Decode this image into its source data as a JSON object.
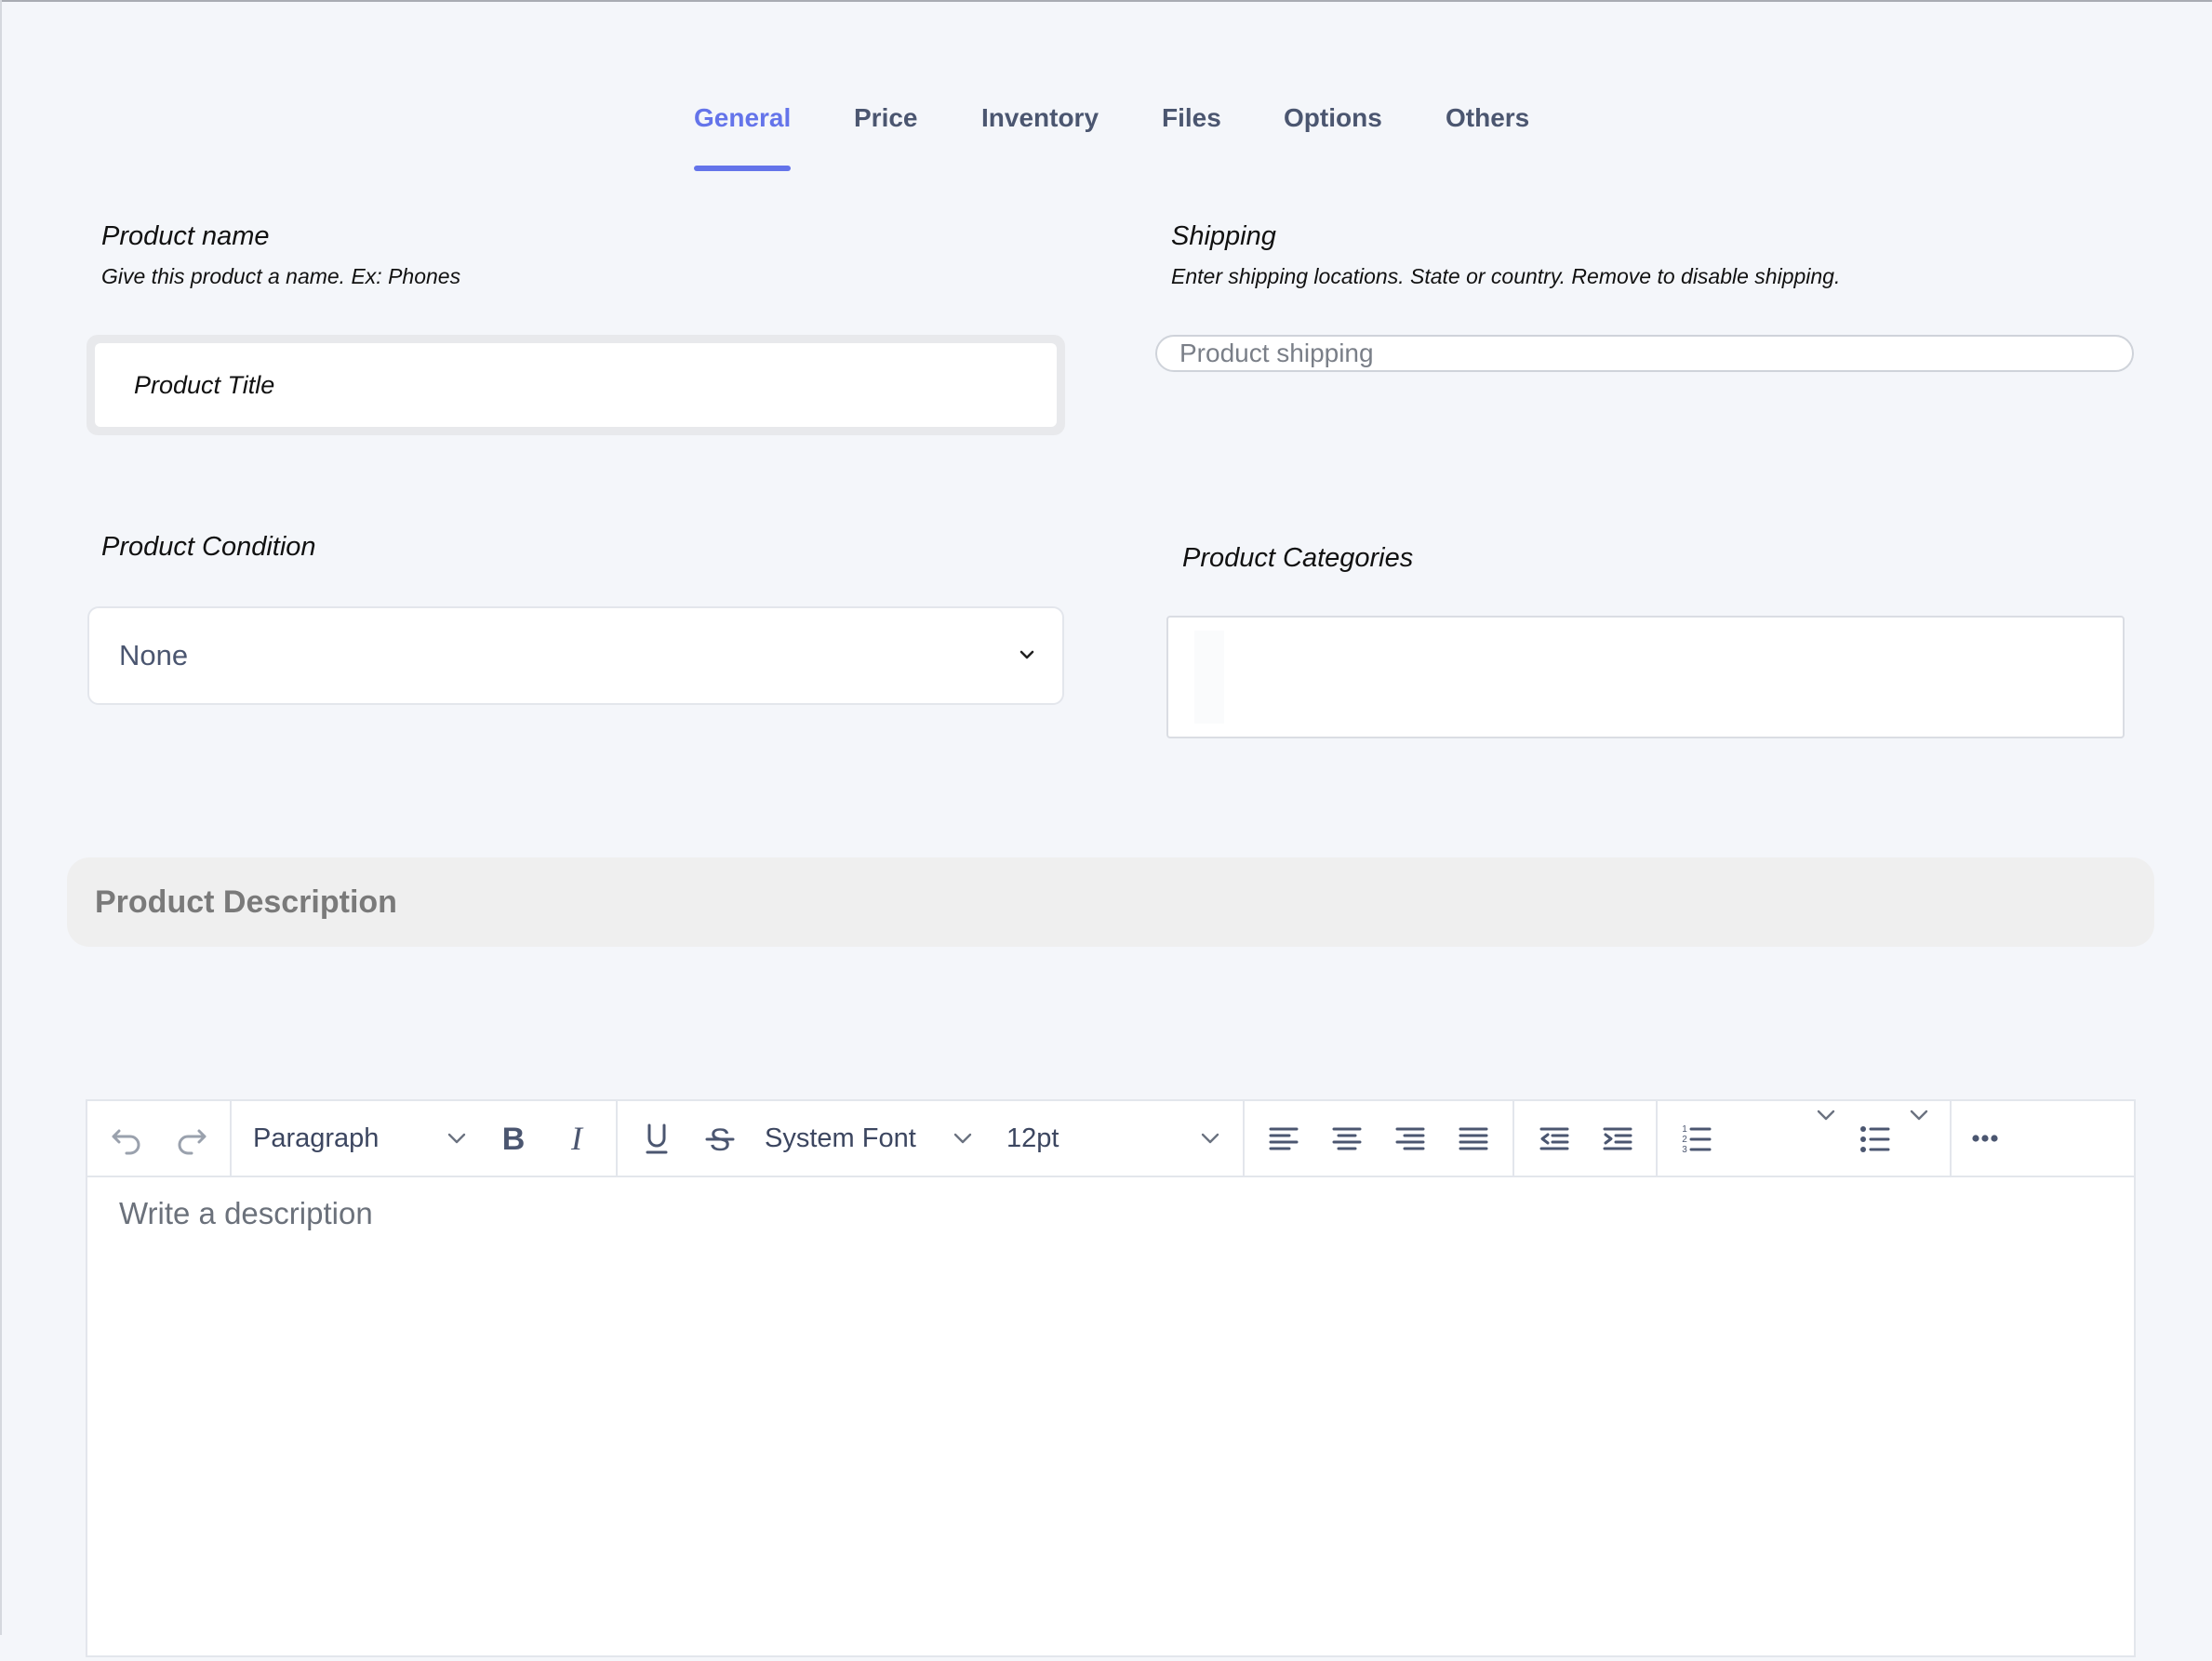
{
  "tabs": {
    "general": "General",
    "price": "Price",
    "inventory": "Inventory",
    "files": "Files",
    "options": "Options",
    "others": "Others"
  },
  "product_name": {
    "label": "Product name",
    "hint": "Give this product a name. Ex: Phones",
    "placeholder": "Product Title"
  },
  "shipping": {
    "label": "Shipping",
    "hint": "Enter shipping locations. State or country. Remove to disable shipping.",
    "placeholder": "Product shipping"
  },
  "condition": {
    "label": "Product Condition",
    "value": "None"
  },
  "categories": {
    "label": "Product Categories"
  },
  "description": {
    "title": "Product Description",
    "placeholder": "Write a description"
  },
  "toolbar": {
    "block_format": "Paragraph",
    "font_family": "System Font",
    "font_size": "12pt"
  },
  "colors": {
    "accent": "#6474ea",
    "text": "#4b5670",
    "background": "#f4f6fa"
  }
}
